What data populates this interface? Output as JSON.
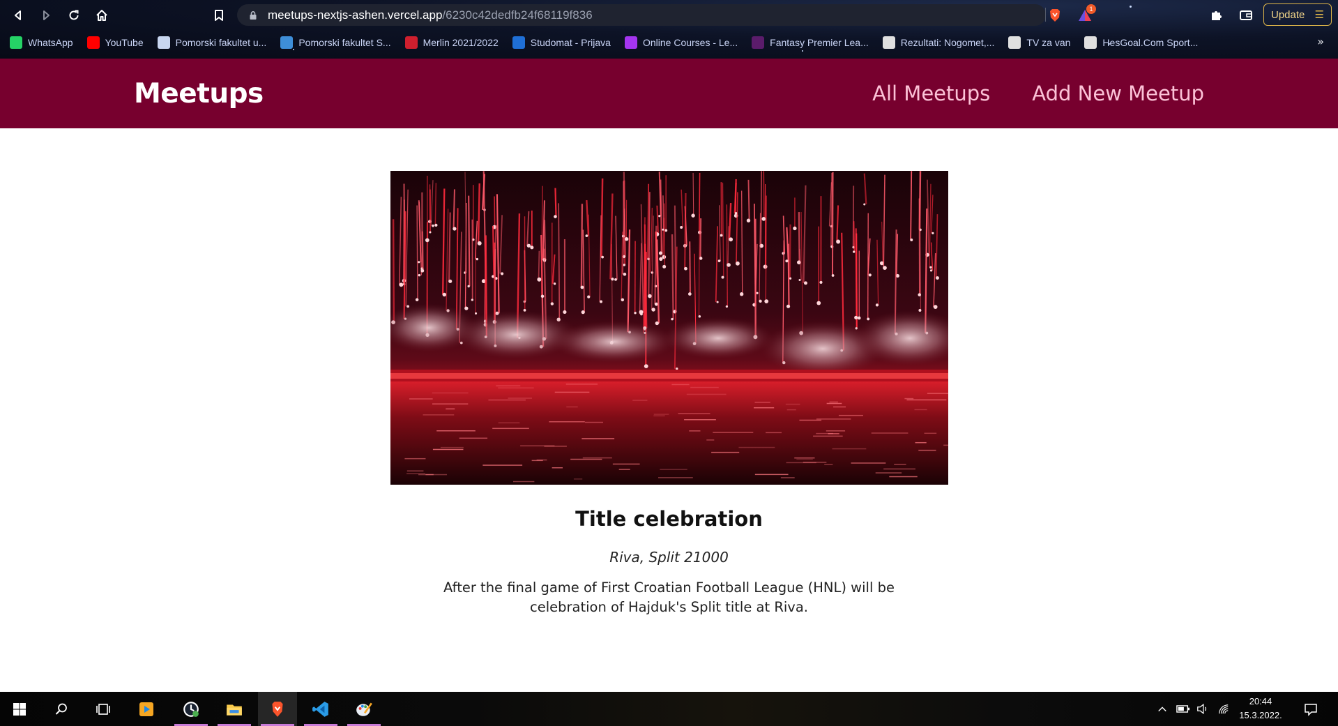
{
  "browser": {
    "url_host": "meetups-nextjs-ashen.vercel.app",
    "url_path": "/6230c42dedfb24f68119f836",
    "brave_badge_count": "1",
    "update_label": "Update",
    "bookmarks": [
      {
        "label": "WhatsApp",
        "icon": "whatsapp-icon",
        "color": "#25d366"
      },
      {
        "label": "YouTube",
        "icon": "youtube-icon",
        "color": "#ff0000"
      },
      {
        "label": "Pomorski fakultet u...",
        "icon": "faculty-icon",
        "color": "#c8d6f0"
      },
      {
        "label": "Pomorski fakultet S...",
        "icon": "faculty-globe-icon",
        "color": "#3e8ed8"
      },
      {
        "label": "Merlin 2021/2022",
        "icon": "merlin-icon",
        "color": "#d01f2e"
      },
      {
        "label": "Studomat - Prijava",
        "icon": "studomat-icon",
        "color": "#1f6fd6"
      },
      {
        "label": "Online Courses - Le...",
        "icon": "udemy-icon",
        "color": "#a435f0"
      },
      {
        "label": "Fantasy Premier Lea...",
        "icon": "premier-league-icon",
        "color": "#5b1c6b"
      },
      {
        "label": "Rezultati: Nogomet,...",
        "icon": "results-icon",
        "color": "#e0e0e0"
      },
      {
        "label": "TV za van",
        "icon": "globe-icon",
        "color": "#e0e0e0"
      },
      {
        "label": "HesGoal.Com Sport...",
        "icon": "ball-icon",
        "color": "#e0e0e0"
      }
    ]
  },
  "site": {
    "logo": "Meetups",
    "nav": [
      "All Meetups",
      "Add New Meetup"
    ],
    "colors": {
      "header_bg": "#77002e",
      "nav_link": "#fcc2d7"
    }
  },
  "meetup": {
    "image_alt": "Title celebration",
    "title": "Title celebration",
    "address": "Riva, Split 21000",
    "description": "After the final game of First Croatian Football League (HNL) will be celebration of Hajduk's Split title at Riva."
  },
  "taskbar": {
    "apps": [
      "start-icon",
      "search-icon",
      "task-view-icon",
      "media-player-icon",
      "clock-app-icon",
      "file-explorer-icon",
      "brave-browser-icon",
      "vscode-icon",
      "paint-icon"
    ],
    "time": "20:44",
    "date": "15.3.2022."
  }
}
